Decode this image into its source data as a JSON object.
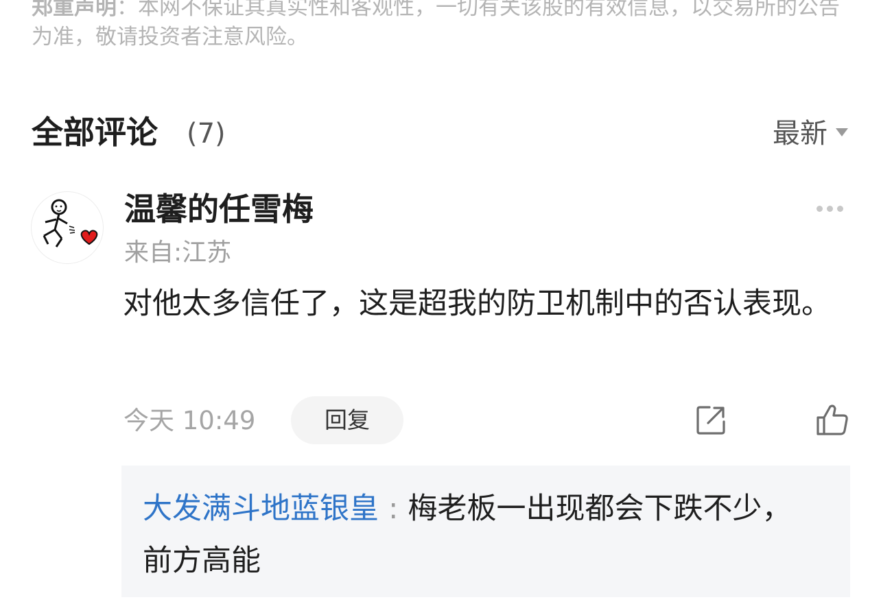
{
  "disclaimer": {
    "label": "郑重声明",
    "text": "：本网不保证其真实性和客观性，一切有关该股的有效信息，以交易所的公告为准，敬请投资者注意风险。"
  },
  "comments": {
    "title": "全部评论",
    "count": "(7)",
    "sort_label": "最新",
    "items": [
      {
        "username": "温馨的任雪梅",
        "location": "来自:江苏",
        "text": "对他太多信任了，这是超我的防卫机制中的否认表现。",
        "time": "今天 10:49",
        "reply_label": "回复",
        "avatar_icon": "stick-figure-heart-avatar",
        "share_icon": "share-icon",
        "like_icon": "thumbs-up-icon",
        "replies": [
          {
            "author": "大发满斗地蓝银皇",
            "separator": ":",
            "text": "梅老板一出现都会下跌不少，前方高能"
          }
        ]
      }
    ]
  },
  "colors": {
    "link_blue": "#2e74c8",
    "muted_gray": "#a5a5a5",
    "reply_bg": "#f5f6f8"
  }
}
